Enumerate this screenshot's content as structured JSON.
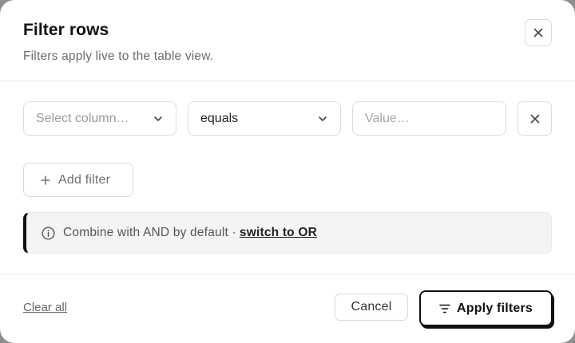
{
  "dialog": {
    "title": "Filter rows",
    "subtitle": "Filters apply live to the table view."
  },
  "filter_row": {
    "column_placeholder": "Select column…",
    "operator_value": "equals",
    "value_placeholder": "Value…"
  },
  "add_filter_label": "Add filter",
  "callout": {
    "text": "Combine with AND by default ·",
    "link": "switch to OR"
  },
  "footer": {
    "clear_all": "Clear all",
    "cancel": "Cancel",
    "apply": "Apply filters"
  },
  "icons": [
    "close-icon",
    "chevron-down-icon",
    "plus-icon",
    "info-icon",
    "filter-icon"
  ],
  "colors": {
    "accent": "#111111",
    "muted_text": "#6b6b6b",
    "border": "#dcdcdc",
    "callout_bg": "#f4f4f4"
  }
}
